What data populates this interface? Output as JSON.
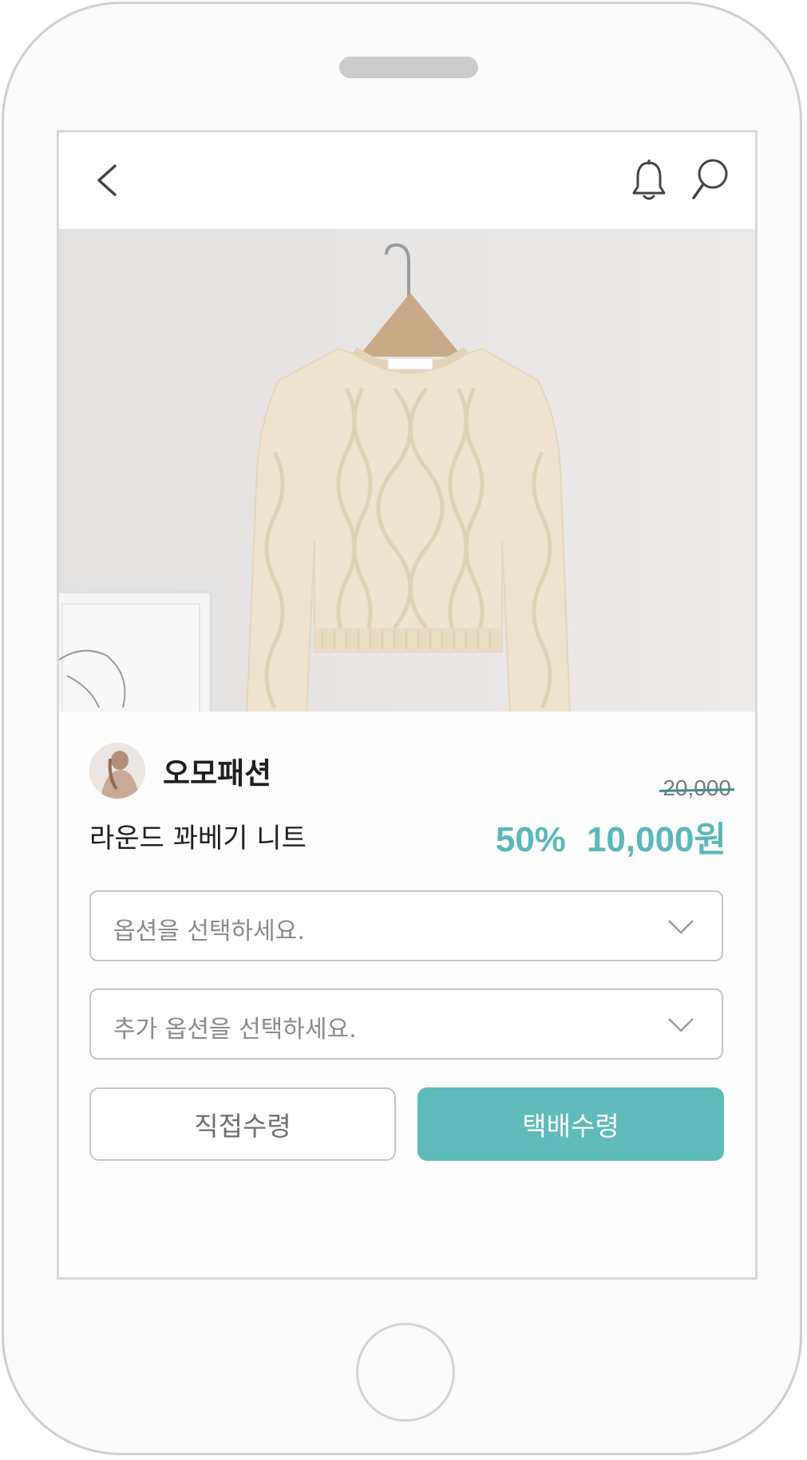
{
  "header": {
    "back_icon": "chevron-left-icon",
    "bell_icon": "bell-icon",
    "search_icon": "search-icon"
  },
  "product_image": {
    "description_icon": "cable-knit-sweater-photo"
  },
  "seller": {
    "name": "오모패션"
  },
  "product": {
    "name": "라운드 꽈베기 니트",
    "original_price": "20,000",
    "discount": "50%",
    "sale_price": "10,000원"
  },
  "options": {
    "primary_placeholder": "옵션을 선택하세요.",
    "secondary_placeholder": "추가 옵션을 선택하세요."
  },
  "actions": {
    "pickup_label": "직접수령",
    "delivery_label": "택배수령"
  },
  "colors": {
    "accent": "#5ebbba",
    "price": "#5ab8b9"
  }
}
